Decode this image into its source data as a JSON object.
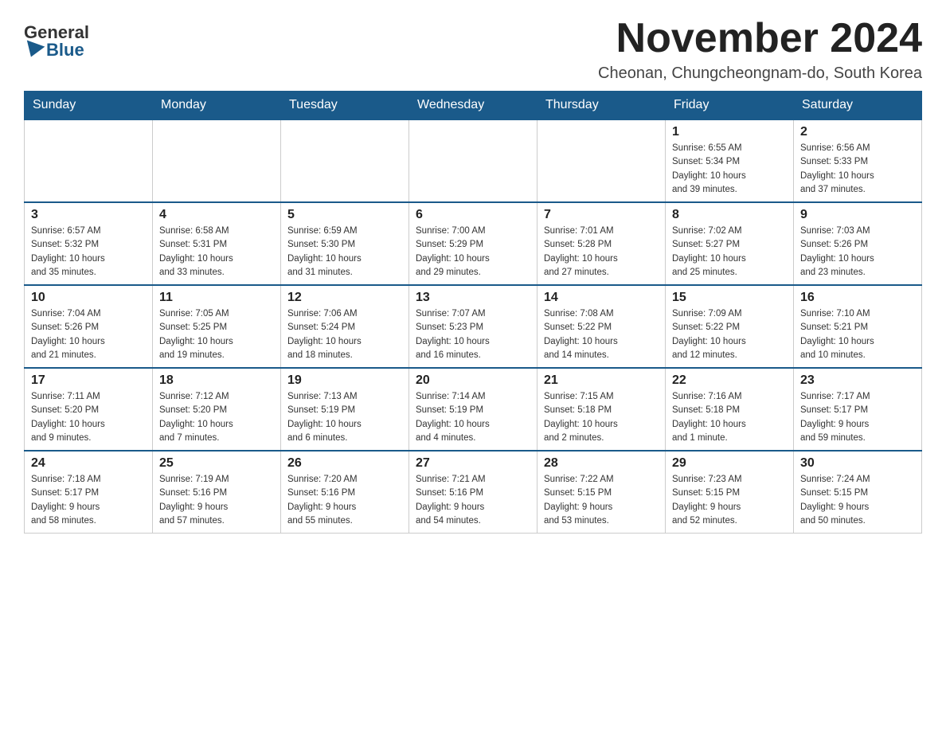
{
  "logo": {
    "general": "General",
    "blue": "Blue"
  },
  "title": "November 2024",
  "location": "Cheonan, Chungcheongnam-do, South Korea",
  "weekdays": [
    "Sunday",
    "Monday",
    "Tuesday",
    "Wednesday",
    "Thursday",
    "Friday",
    "Saturday"
  ],
  "weeks": [
    [
      {
        "day": "",
        "info": ""
      },
      {
        "day": "",
        "info": ""
      },
      {
        "day": "",
        "info": ""
      },
      {
        "day": "",
        "info": ""
      },
      {
        "day": "",
        "info": ""
      },
      {
        "day": "1",
        "info": "Sunrise: 6:55 AM\nSunset: 5:34 PM\nDaylight: 10 hours\nand 39 minutes."
      },
      {
        "day": "2",
        "info": "Sunrise: 6:56 AM\nSunset: 5:33 PM\nDaylight: 10 hours\nand 37 minutes."
      }
    ],
    [
      {
        "day": "3",
        "info": "Sunrise: 6:57 AM\nSunset: 5:32 PM\nDaylight: 10 hours\nand 35 minutes."
      },
      {
        "day": "4",
        "info": "Sunrise: 6:58 AM\nSunset: 5:31 PM\nDaylight: 10 hours\nand 33 minutes."
      },
      {
        "day": "5",
        "info": "Sunrise: 6:59 AM\nSunset: 5:30 PM\nDaylight: 10 hours\nand 31 minutes."
      },
      {
        "day": "6",
        "info": "Sunrise: 7:00 AM\nSunset: 5:29 PM\nDaylight: 10 hours\nand 29 minutes."
      },
      {
        "day": "7",
        "info": "Sunrise: 7:01 AM\nSunset: 5:28 PM\nDaylight: 10 hours\nand 27 minutes."
      },
      {
        "day": "8",
        "info": "Sunrise: 7:02 AM\nSunset: 5:27 PM\nDaylight: 10 hours\nand 25 minutes."
      },
      {
        "day": "9",
        "info": "Sunrise: 7:03 AM\nSunset: 5:26 PM\nDaylight: 10 hours\nand 23 minutes."
      }
    ],
    [
      {
        "day": "10",
        "info": "Sunrise: 7:04 AM\nSunset: 5:26 PM\nDaylight: 10 hours\nand 21 minutes."
      },
      {
        "day": "11",
        "info": "Sunrise: 7:05 AM\nSunset: 5:25 PM\nDaylight: 10 hours\nand 19 minutes."
      },
      {
        "day": "12",
        "info": "Sunrise: 7:06 AM\nSunset: 5:24 PM\nDaylight: 10 hours\nand 18 minutes."
      },
      {
        "day": "13",
        "info": "Sunrise: 7:07 AM\nSunset: 5:23 PM\nDaylight: 10 hours\nand 16 minutes."
      },
      {
        "day": "14",
        "info": "Sunrise: 7:08 AM\nSunset: 5:22 PM\nDaylight: 10 hours\nand 14 minutes."
      },
      {
        "day": "15",
        "info": "Sunrise: 7:09 AM\nSunset: 5:22 PM\nDaylight: 10 hours\nand 12 minutes."
      },
      {
        "day": "16",
        "info": "Sunrise: 7:10 AM\nSunset: 5:21 PM\nDaylight: 10 hours\nand 10 minutes."
      }
    ],
    [
      {
        "day": "17",
        "info": "Sunrise: 7:11 AM\nSunset: 5:20 PM\nDaylight: 10 hours\nand 9 minutes."
      },
      {
        "day": "18",
        "info": "Sunrise: 7:12 AM\nSunset: 5:20 PM\nDaylight: 10 hours\nand 7 minutes."
      },
      {
        "day": "19",
        "info": "Sunrise: 7:13 AM\nSunset: 5:19 PM\nDaylight: 10 hours\nand 6 minutes."
      },
      {
        "day": "20",
        "info": "Sunrise: 7:14 AM\nSunset: 5:19 PM\nDaylight: 10 hours\nand 4 minutes."
      },
      {
        "day": "21",
        "info": "Sunrise: 7:15 AM\nSunset: 5:18 PM\nDaylight: 10 hours\nand 2 minutes."
      },
      {
        "day": "22",
        "info": "Sunrise: 7:16 AM\nSunset: 5:18 PM\nDaylight: 10 hours\nand 1 minute."
      },
      {
        "day": "23",
        "info": "Sunrise: 7:17 AM\nSunset: 5:17 PM\nDaylight: 9 hours\nand 59 minutes."
      }
    ],
    [
      {
        "day": "24",
        "info": "Sunrise: 7:18 AM\nSunset: 5:17 PM\nDaylight: 9 hours\nand 58 minutes."
      },
      {
        "day": "25",
        "info": "Sunrise: 7:19 AM\nSunset: 5:16 PM\nDaylight: 9 hours\nand 57 minutes."
      },
      {
        "day": "26",
        "info": "Sunrise: 7:20 AM\nSunset: 5:16 PM\nDaylight: 9 hours\nand 55 minutes."
      },
      {
        "day": "27",
        "info": "Sunrise: 7:21 AM\nSunset: 5:16 PM\nDaylight: 9 hours\nand 54 minutes."
      },
      {
        "day": "28",
        "info": "Sunrise: 7:22 AM\nSunset: 5:15 PM\nDaylight: 9 hours\nand 53 minutes."
      },
      {
        "day": "29",
        "info": "Sunrise: 7:23 AM\nSunset: 5:15 PM\nDaylight: 9 hours\nand 52 minutes."
      },
      {
        "day": "30",
        "info": "Sunrise: 7:24 AM\nSunset: 5:15 PM\nDaylight: 9 hours\nand 50 minutes."
      }
    ]
  ]
}
